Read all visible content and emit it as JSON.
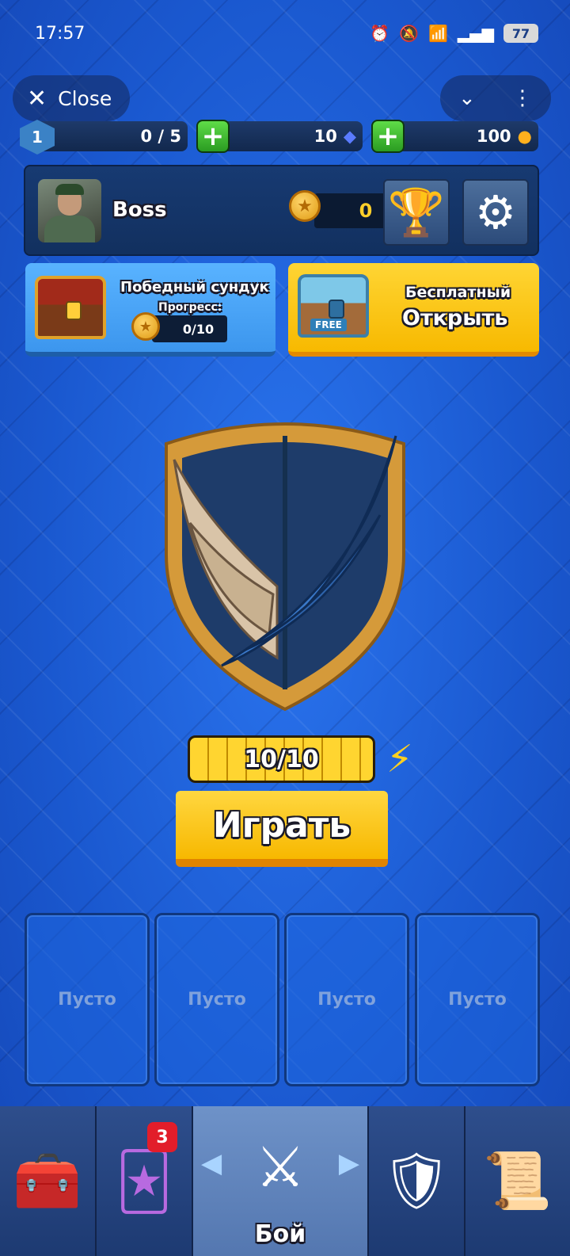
{
  "status_bar": {
    "time": "17:57",
    "battery": "77"
  },
  "window": {
    "close_label": "Close"
  },
  "resources": {
    "level": "1",
    "xp": "0 / 5",
    "gems": "10",
    "coins": "100"
  },
  "profile": {
    "name": "Boss",
    "trophies": "0"
  },
  "victory_chest": {
    "title": "Победный сундук",
    "progress_label": "Прогресс:",
    "progress_value": "0/10"
  },
  "free_chest": {
    "title": "Бесплатный",
    "action": "Открыть",
    "tag": "FREE"
  },
  "energy": {
    "value": "10/10"
  },
  "play": {
    "label": "Играть"
  },
  "slots": [
    {
      "label": "Пусто"
    },
    {
      "label": "Пусто"
    },
    {
      "label": "Пусто"
    },
    {
      "label": "Пусто"
    }
  ],
  "nav": {
    "cards_badge": "3",
    "battle_label": "Бой"
  },
  "colors": {
    "background": "#1c5fd8",
    "play_button": "#ffd740",
    "plus_button": "#3fbf30",
    "badge": "#e21d2a"
  }
}
